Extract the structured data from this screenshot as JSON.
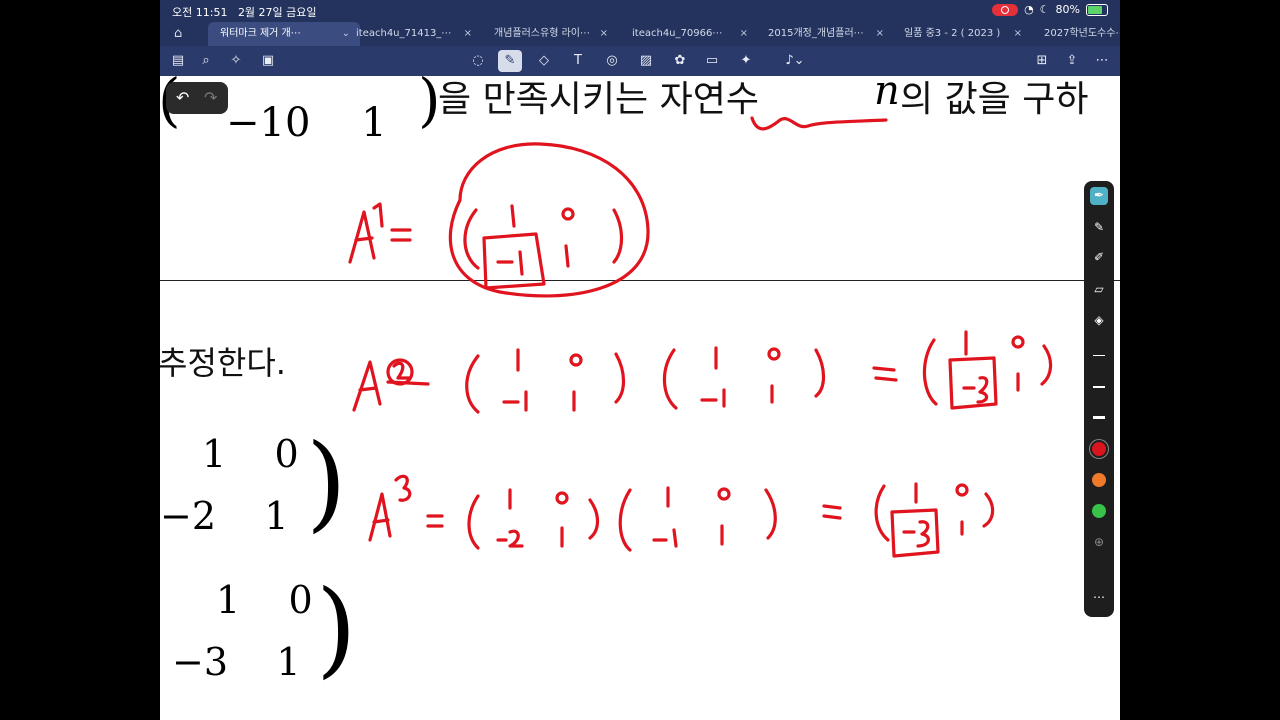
{
  "status_bar": {
    "time": "오전 11:51",
    "date": "2월 27일 금요일",
    "battery": "80%"
  },
  "tabs": [
    {
      "label": "워터마크 제거 개⋯",
      "active": true
    },
    {
      "label": "iteach4u_71413_⋯",
      "active": false
    },
    {
      "label": "개념플러스유형 라이⋯",
      "active": false
    },
    {
      "label": "iteach4u_70966⋯",
      "active": false
    },
    {
      "label": "2015개정_개념플러⋯",
      "active": false
    },
    {
      "label": "일품 중3 - 2 ( 2023 )",
      "active": false
    },
    {
      "label": "2027학년도수수⋯",
      "active": false
    }
  ],
  "tab_close": "×",
  "home_icon_label": "⌂",
  "toolbar": {
    "icons": [
      "sidebar-icon",
      "search-icon",
      "ai-sparkle-icon",
      "document-icon",
      "lasso-icon",
      "pen-icon",
      "eraser-icon",
      "textbox-icon",
      "shapes-icon",
      "image-icon",
      "sticker-icon",
      "note-icon",
      "laser-icon",
      "microphone-icon",
      "add-page-icon",
      "share-icon",
      "more-icon"
    ]
  },
  "undo": {
    "undo": "↶",
    "redo": "↷"
  },
  "document": {
    "top_matrix_left": "(",
    "top_matrix_row": "−10    1",
    "top_matrix_right": ")",
    "top_text": "을 만족시키는 자연수",
    "top_var": "n",
    "top_text2": "의 값을 구하",
    "estimate_text": "추정한다.",
    "matrix2_row1": "1    0",
    "matrix2_row2": "−2    1",
    "matrix3_row1": "1    0",
    "matrix3_row2": "−3    1"
  },
  "ink_color": "#e0141e",
  "pen_colors": [
    "#d8141c",
    "#f07a2c",
    "#38c24a"
  ]
}
